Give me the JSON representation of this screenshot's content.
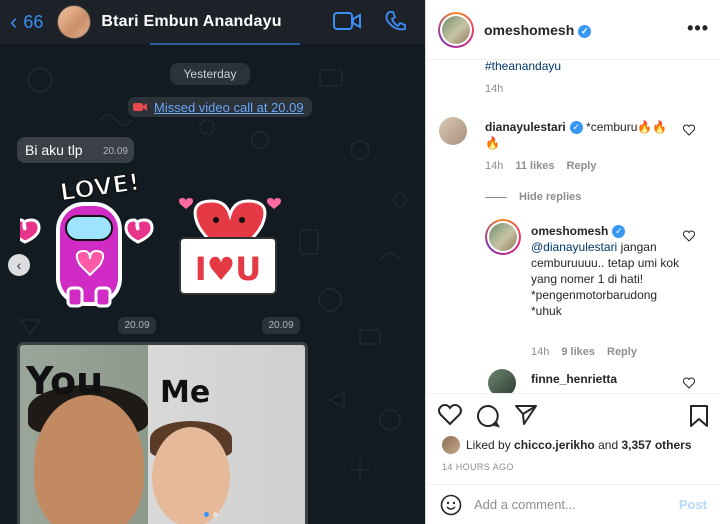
{
  "chat": {
    "back_count": "66",
    "contact_name": "Btari Embun Anandayu",
    "day_label": "Yesterday",
    "missed_call": "Missed video call at 20.09",
    "message_text": "Bi aku tlp",
    "message_time": "20.09",
    "sticker_time_1": "20.09",
    "sticker_time_2": "20.09",
    "sticker1_text": "LOVE!",
    "sticker2_text": "I♥U",
    "photo_text_you": "You",
    "photo_text_me": "Me"
  },
  "instagram": {
    "username": "omeshomesh",
    "hashtag": "#theanandayu",
    "caption_time": "14h",
    "comment1": {
      "user": "dianayulestari",
      "text": "*cemburu🔥🔥🔥",
      "time": "14h",
      "likes": "11 likes",
      "reply": "Reply"
    },
    "hide_replies": "Hide replies",
    "reply1": {
      "user": "omeshomesh",
      "mention": "@dianayulestari",
      "text": "jangan cemburuuuu.. tetap umi kok yang nomer 1 di hati! *pengenmotorbarudong *uhuk",
      "time": "14h",
      "likes": "9 likes",
      "reply": "Reply"
    },
    "reply2_user": "finne_henrietta",
    "liked_by_prefix": "Liked by",
    "liked_by_user": "chicco.jerikho",
    "liked_by_and": "and",
    "liked_by_count": "3,357 others",
    "post_time": "14 HOURS AGO",
    "add_comment_placeholder": "Add a comment...",
    "post_button": "Post"
  },
  "colors": {
    "ios_blue": "#3b8ef5",
    "ig_verified": "#3897f0",
    "ig_link": "#00376b"
  }
}
